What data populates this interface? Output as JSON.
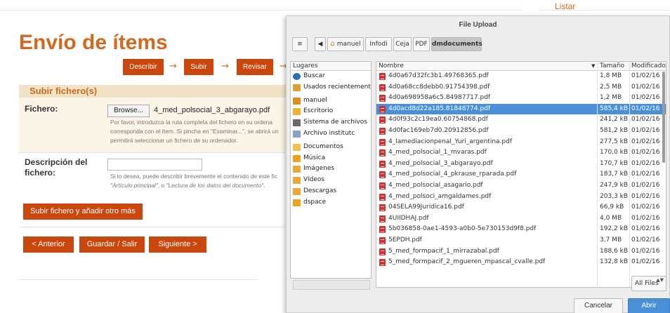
{
  "page": {
    "right_title": "Listar",
    "title": "Envío de ítems",
    "steps": [
      "Describir",
      "Subir",
      "Revisar"
    ],
    "step_arrow": "→",
    "panel_title": "Subir fichero(s)",
    "file_label": "Fichero:",
    "browse_label": "Browse...",
    "browse_filename": "4_med_polsocial_3_abgarayo.pdf",
    "file_help": [
      "Por favor, introduzca la ruta completa del fichero en su ordena",
      "corresponda con el ítem. Si pincha en \"Examinar...\", se abrirá un",
      "permitirá seleccionar un fichero de su ordenador."
    ],
    "desc_label_1": "Descripción del",
    "desc_label_2": "fichero:",
    "desc_help_1": "Si lo desea, puede describir brevemente el contenido de este fic",
    "desc_help_2a": "\"Artículo principal\"",
    "desc_help_2b": ", o ",
    "desc_help_2c": "\"Lectura de los datos del documento\"",
    "desc_help_2d": ".",
    "upload_more_button": "Subir fichero y añadir otro más",
    "prev_button": "< Anterior",
    "save_button": "Guardar / Salir",
    "next_button": "Siguiente >",
    "accent": "#c9470d"
  },
  "dialog": {
    "title": "File Upload",
    "toggle_icon": "pencil-edit-icon",
    "path": [
      "manuel",
      "Infodi",
      "Ceja",
      "PDF",
      "dmdocuments"
    ],
    "active_path": "dmdocuments",
    "places_header": "Lugares",
    "places": [
      {
        "label": "Buscar",
        "icon": "search-icon"
      },
      {
        "label": "Usados recientemente",
        "icon": "recent-icon"
      },
      {
        "label": "manuel",
        "icon": "home-icon"
      },
      {
        "label": "Escritorio",
        "icon": "desktop-icon"
      },
      {
        "label": "Sistema de archivos",
        "icon": "drive-icon"
      },
      {
        "label": "Archivo institutc",
        "icon": "network-icon"
      },
      {
        "label": "Documentos",
        "icon": "documents-icon"
      },
      {
        "label": "Música",
        "icon": "music-icon"
      },
      {
        "label": "Imágenes",
        "icon": "pictures-icon"
      },
      {
        "label": "Vídeos",
        "icon": "videos-icon"
      },
      {
        "label": "Descargas",
        "icon": "downloads-icon"
      },
      {
        "label": "dspace",
        "icon": "folder-icon"
      }
    ],
    "columns": {
      "name": "Nombre",
      "sort": "▼",
      "size": "Tamaño",
      "modified": "Modificado"
    },
    "files": [
      {
        "name": "4d0a67d32fc3b1.49768365.pdf",
        "size": "1,8 MB",
        "date": "01/02/16"
      },
      {
        "name": "4d0a68cc8debb0.91754398.pdf",
        "size": "2,5 MB",
        "date": "01/02/16"
      },
      {
        "name": "4d0a698958a6c5.84987717.pdf",
        "size": "1,2 MB",
        "date": "01/02/16"
      },
      {
        "name": "4d0acd8d22a185.81848774.pdf",
        "size": "585,4 kB",
        "date": "01/02/16",
        "selected": true
      },
      {
        "name": "4d0f93c2c19ea0.60754868.pdf",
        "size": "241,2 kB",
        "date": "01/02/16"
      },
      {
        "name": "4d0fac169eb7d0.20912856.pdf",
        "size": "581,2 kB",
        "date": "01/02/16"
      },
      {
        "name": "4_lamediacionpenal_Yuri_argentina.pdf",
        "size": "277,5 kB",
        "date": "01/02/16"
      },
      {
        "name": "4_med_polsocial_1_mvaras.pdf",
        "size": "170,0 kB",
        "date": "01/02/16"
      },
      {
        "name": "4_med_polsocial_3_abgarayo.pdf",
        "size": "170,7 kB",
        "date": "01/02/16"
      },
      {
        "name": "4_med_polsocial_4_pkrause_rparada.pdf",
        "size": "183,7 kB",
        "date": "01/02/16"
      },
      {
        "name": "4_med_polsocial_asagario.pdf",
        "size": "247,9 kB",
        "date": "01/02/16"
      },
      {
        "name": "4_med_polsoci_amgaldames.pdf",
        "size": "203,3 kB",
        "date": "01/02/16"
      },
      {
        "name": "04SELA99Juridica16.pdf",
        "size": "66,9 kB",
        "date": "01/02/16"
      },
      {
        "name": "4UIIDHAJ.pdf",
        "size": "4,0 MB",
        "date": "01/02/16"
      },
      {
        "name": "5b036858-0ae1-4593-a0b0-5e730153d9f8.pdf",
        "size": "192,2 kB",
        "date": "01/02/16"
      },
      {
        "name": "5EPDH.pdf",
        "size": "3,7 MB",
        "date": "01/02/16"
      },
      {
        "name": "5_med_formpacif_1_mirrazabal.pdf",
        "size": "188,6 kB",
        "date": "01/02/16"
      },
      {
        "name": "5_med_formpacif_2_mgueren_mpascal_cvalle.pdf",
        "size": "132,8 kB",
        "date": "01/02/16"
      }
    ],
    "filter": "All Files",
    "filter_spin": "▲▼",
    "cancel": "Cancelar",
    "open": "Abrir",
    "selection_color": "#4a90d9"
  }
}
